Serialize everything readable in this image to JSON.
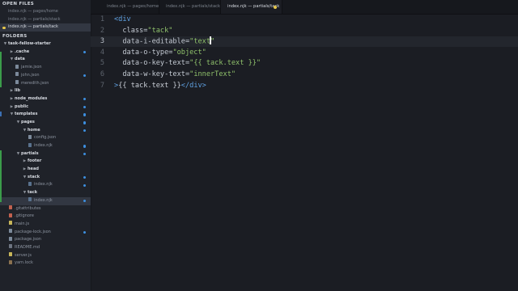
{
  "sidebar": {
    "open_files_heading": "OPEN FILES",
    "open_files": [
      {
        "label": "index.njk — pages/home",
        "active": false,
        "unsaved": false
      },
      {
        "label": "index.njk — partials/stack",
        "active": false,
        "unsaved": false
      },
      {
        "label": "index.njk — partials/tack",
        "active": true,
        "unsaved": true
      }
    ],
    "folders_heading": "FOLDERS",
    "tree": [
      {
        "label": "task-fellow-starter",
        "indent": 0,
        "kind": "dir",
        "caret": "▼",
        "badge": false
      },
      {
        "label": ".cache",
        "indent": 1,
        "kind": "dir",
        "caret": "▶",
        "badge": true
      },
      {
        "label": "data",
        "indent": 1,
        "kind": "dir",
        "caret": "▼",
        "badge": false
      },
      {
        "label": "jamie.json",
        "indent": 2,
        "kind": "file",
        "icon": "json-file-icon",
        "badge": false
      },
      {
        "label": "john.json",
        "indent": 2,
        "kind": "file",
        "icon": "json-file-icon",
        "badge": true
      },
      {
        "label": "meredith.json",
        "indent": 2,
        "kind": "file",
        "icon": "json-file-icon",
        "badge": false
      },
      {
        "label": "lib",
        "indent": 1,
        "kind": "dir",
        "caret": "▶",
        "badge": false
      },
      {
        "label": "node_modules",
        "indent": 1,
        "kind": "dir",
        "caret": "▶",
        "badge": true
      },
      {
        "label": "public",
        "indent": 1,
        "kind": "dir",
        "caret": "▶",
        "badge": true
      },
      {
        "label": "templates",
        "indent": 1,
        "kind": "dir",
        "caret": "▼",
        "badge": true
      },
      {
        "label": "pages",
        "indent": 2,
        "kind": "dir",
        "caret": "▼",
        "badge": true
      },
      {
        "label": "home",
        "indent": 3,
        "kind": "dir",
        "caret": "▼",
        "badge": true
      },
      {
        "label": "config.json",
        "indent": 4,
        "kind": "file",
        "icon": "json-file-icon",
        "badge": false
      },
      {
        "label": "index.njk",
        "indent": 4,
        "kind": "file",
        "icon": "njk-file-icon",
        "badge": true
      },
      {
        "label": "partials",
        "indent": 2,
        "kind": "dir",
        "caret": "▼",
        "badge": true
      },
      {
        "label": "footer",
        "indent": 3,
        "kind": "dir",
        "caret": "▶",
        "badge": false
      },
      {
        "label": "head",
        "indent": 3,
        "kind": "dir",
        "caret": "▶",
        "badge": false
      },
      {
        "label": "stack",
        "indent": 3,
        "kind": "dir",
        "caret": "▼",
        "badge": true
      },
      {
        "label": "index.njk",
        "indent": 4,
        "kind": "file",
        "icon": "njk-file-icon",
        "badge": true
      },
      {
        "label": "tack",
        "indent": 3,
        "kind": "dir",
        "caret": "▼",
        "badge": false
      },
      {
        "label": "index.njk",
        "indent": 4,
        "kind": "file",
        "icon": "njk-file-icon",
        "badge": true,
        "active": true
      },
      {
        "label": ".gitattributes",
        "indent": 1,
        "kind": "file",
        "icon": "git-file-icon",
        "badge": false
      },
      {
        "label": ".gitignore",
        "indent": 1,
        "kind": "file",
        "icon": "git-file-icon",
        "badge": false
      },
      {
        "label": "main.js",
        "indent": 1,
        "kind": "file",
        "icon": "js-file-icon",
        "badge": false
      },
      {
        "label": "package-lock.json",
        "indent": 1,
        "kind": "file",
        "icon": "json-file-icon",
        "badge": true
      },
      {
        "label": "package.json",
        "indent": 1,
        "kind": "file",
        "icon": "json-file-icon",
        "badge": false
      },
      {
        "label": "README.md",
        "indent": 1,
        "kind": "file",
        "icon": "md-file-icon",
        "badge": false
      },
      {
        "label": "server.js",
        "indent": 1,
        "kind": "file",
        "icon": "js-file-icon",
        "badge": false
      },
      {
        "label": "yarn.lock",
        "indent": 1,
        "kind": "file",
        "icon": "lock-file-icon",
        "badge": false
      }
    ]
  },
  "tabs": [
    {
      "label": "index.njk — pages/home",
      "active": false,
      "dirty": false
    },
    {
      "label": "index.njk — partials/stack",
      "active": false,
      "dirty": false
    },
    {
      "label": "index.njk — partials/tack",
      "active": true,
      "dirty": true
    }
  ],
  "editor": {
    "current_line": 2,
    "lines": [
      {
        "num": "1",
        "tokens": [
          {
            "t": "tag",
            "v": "<div"
          }
        ]
      },
      {
        "num": "2",
        "tokens": [
          {
            "t": "attr",
            "v": "  class="
          },
          {
            "t": "str",
            "v": "\"tack\""
          }
        ]
      },
      {
        "num": "3",
        "tokens": [
          {
            "t": "attr",
            "v": "  data-i-editable="
          },
          {
            "t": "str",
            "v": "\"text"
          },
          {
            "t": "cursor",
            "v": ""
          },
          {
            "t": "str",
            "v": "\""
          }
        ]
      },
      {
        "num": "4",
        "tokens": [
          {
            "t": "attr",
            "v": "  data-o-type="
          },
          {
            "t": "str",
            "v": "\"object\""
          }
        ]
      },
      {
        "num": "5",
        "tokens": [
          {
            "t": "attr",
            "v": "  data-o-key-text="
          },
          {
            "t": "str",
            "v": "\"{{ tack.text }}\""
          }
        ]
      },
      {
        "num": "6",
        "tokens": [
          {
            "t": "attr",
            "v": "  data-w-key-text="
          },
          {
            "t": "str",
            "v": "\"innerText\""
          }
        ]
      },
      {
        "num": "7",
        "tokens": [
          {
            "t": "tag",
            "v": ">"
          },
          {
            "t": "tpl",
            "v": "{{ tack.text }}"
          },
          {
            "t": "tag",
            "v": "</div>"
          }
        ]
      }
    ]
  },
  "colors": {
    "background": "#1b1d23",
    "sidebar": "#1f2229",
    "accent_unsaved": "#e6c64a",
    "badge_blue": "#3d8fe0",
    "tag": "#5fa0e0",
    "string": "#8fc16b"
  }
}
